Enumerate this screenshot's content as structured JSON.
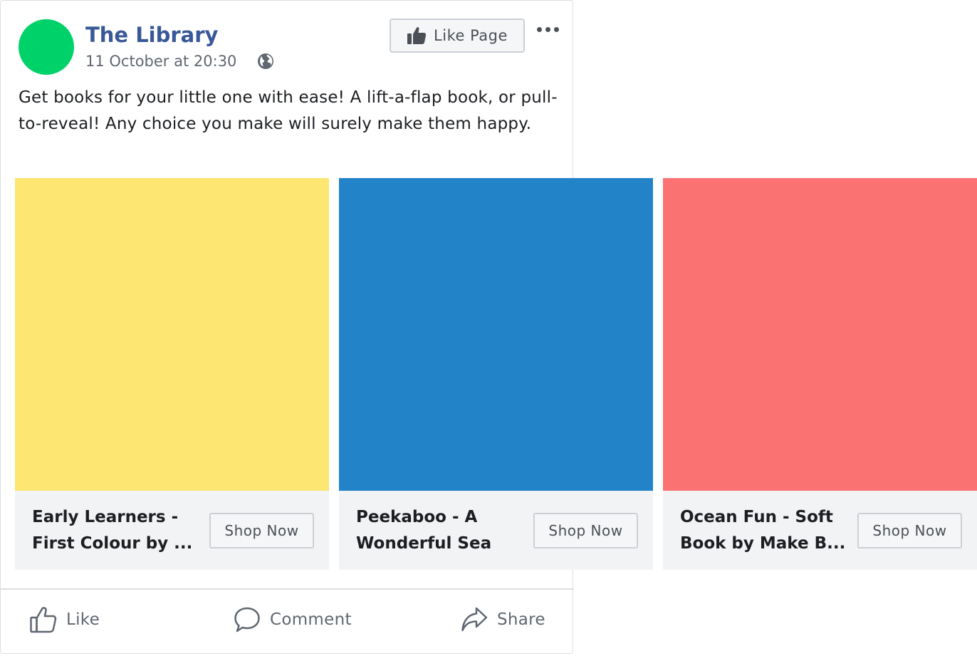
{
  "post": {
    "page_name": "The Library",
    "timestamp": "11 October at 20:30",
    "audience_icon": "globe-icon",
    "avatar_color": "#00d26a",
    "like_page_label": "Like Page",
    "like_page_icon": "thumbs-up-icon",
    "more_icon": "more-options-icon",
    "text": "Get books for your little one with ease! A lift-a-flap book, or pull-to-reveal! Any choice you make will surely make them happy."
  },
  "carousel": {
    "cards": [
      {
        "title": "Early Learners - First Colour by ...",
        "button": "Shop Now",
        "image_color": "#fde671"
      },
      {
        "title": "Peekaboo - A Wonderful Sea",
        "button": "Shop Now",
        "image_color": "#2283c9"
      },
      {
        "title": "Ocean Fun - Soft Book by Make B...",
        "button": "Shop Now",
        "image_color": "#fb7272"
      }
    ]
  },
  "actions": {
    "like": {
      "label": "Like",
      "icon": "thumbs-up-outline-icon"
    },
    "comment": {
      "label": "Comment",
      "icon": "speech-bubble-icon"
    },
    "share": {
      "label": "Share",
      "icon": "share-arrow-icon"
    }
  },
  "colors": {
    "page_name": "#385898",
    "secondary_text": "#606770",
    "card_background": "#f2f3f5"
  }
}
